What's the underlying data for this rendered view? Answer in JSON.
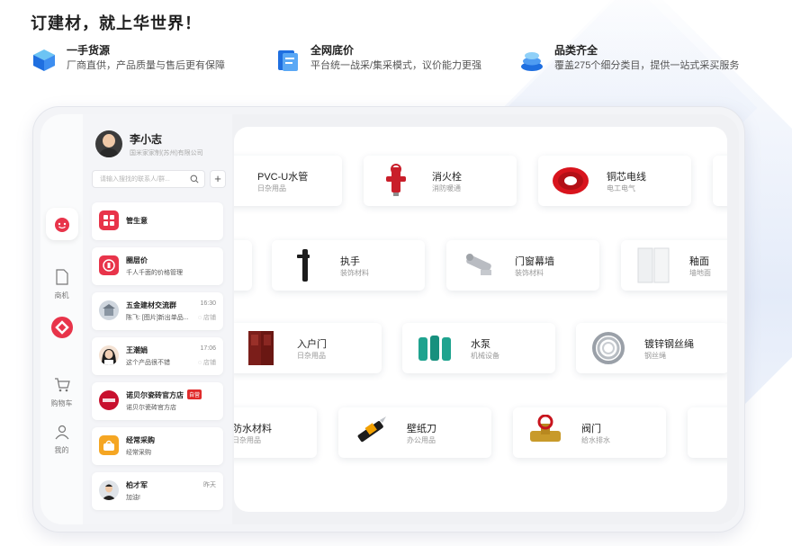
{
  "hero": {
    "title": "订建材，就上华世界！"
  },
  "features": [
    {
      "title": "一手货源",
      "desc": "厂商直供，产品质量与售后更有保障",
      "icon": "box-source-icon"
    },
    {
      "title": "全网底价",
      "desc": "平台统一战采/集采模式，议价能力更强",
      "icon": "price-tag-icon"
    },
    {
      "title": "品类齐全",
      "desc": "覆盖275个细分类目，提供一站式采买服务",
      "icon": "category-stack-icon"
    }
  ],
  "rail": [
    {
      "label": "",
      "icon": "chat-smile-icon",
      "active": true
    },
    {
      "label": "商机",
      "icon": "document-icon"
    },
    {
      "label": "",
      "icon": "diamond-logo-icon"
    },
    {
      "label": "购物车",
      "icon": "cart-icon"
    },
    {
      "label": "我的",
      "icon": "person-icon"
    }
  ],
  "user": {
    "name": "李小志",
    "company": "国米家家制(苏州)有限公司"
  },
  "search": {
    "placeholder": "请输入搜找的联系人/群..."
  },
  "conversations": [
    {
      "name": "管生意",
      "sub": "",
      "time": "",
      "status": "",
      "color": "#e8344a"
    },
    {
      "name": "圈层价",
      "sub": "千人千面的价格管理",
      "time": "",
      "status": "",
      "color": "#e8344a"
    },
    {
      "name": "五金建材交流群",
      "sub": "陈飞: [图片]新出单品...",
      "time": "16:30",
      "status": "◌ 店铺",
      "color": "#c9d2dc"
    },
    {
      "name": "王潮娟",
      "sub": "这个产品很不错",
      "time": "17:06",
      "status": "◌ 店铺",
      "color": "#2a2a2a"
    },
    {
      "name": "诺贝尔瓷砖官方店",
      "sub": "诺贝尔瓷砖官方店",
      "time": "",
      "status": "",
      "badge": "自营",
      "color": "#c8102e"
    },
    {
      "name": "经常采购",
      "sub": "经常采购",
      "time": "",
      "status": "",
      "color": "#f5a623"
    },
    {
      "name": "柏才军",
      "sub": "加油!",
      "time": "昨天",
      "status": "",
      "color": "#2a2a2a"
    }
  ],
  "products": [
    {
      "name": "PVC-U水管",
      "cat": "日杂用品"
    },
    {
      "name": "消火栓",
      "cat": "消防暖通"
    },
    {
      "name": "铜芯电线",
      "cat": "电工电气"
    },
    {
      "name": "",
      "cat": ""
    },
    {
      "name": "",
      "cat": ""
    },
    {
      "name": "执手",
      "cat": "装饰材料"
    },
    {
      "name": "门窗幕墙",
      "cat": "装饰材料"
    },
    {
      "name": "釉面",
      "cat": "墙地面"
    },
    {
      "name": "入户门",
      "cat": "日杂用品"
    },
    {
      "name": "水泵",
      "cat": "机械设备"
    },
    {
      "name": "镀锌钢丝绳",
      "cat": "钢丝绳"
    },
    {
      "name": "防水材料",
      "cat": "日杂用品"
    },
    {
      "name": "壁纸刀",
      "cat": "办公用品"
    },
    {
      "name": "阀门",
      "cat": "给水排水"
    },
    {
      "name": "",
      "cat": ""
    }
  ]
}
